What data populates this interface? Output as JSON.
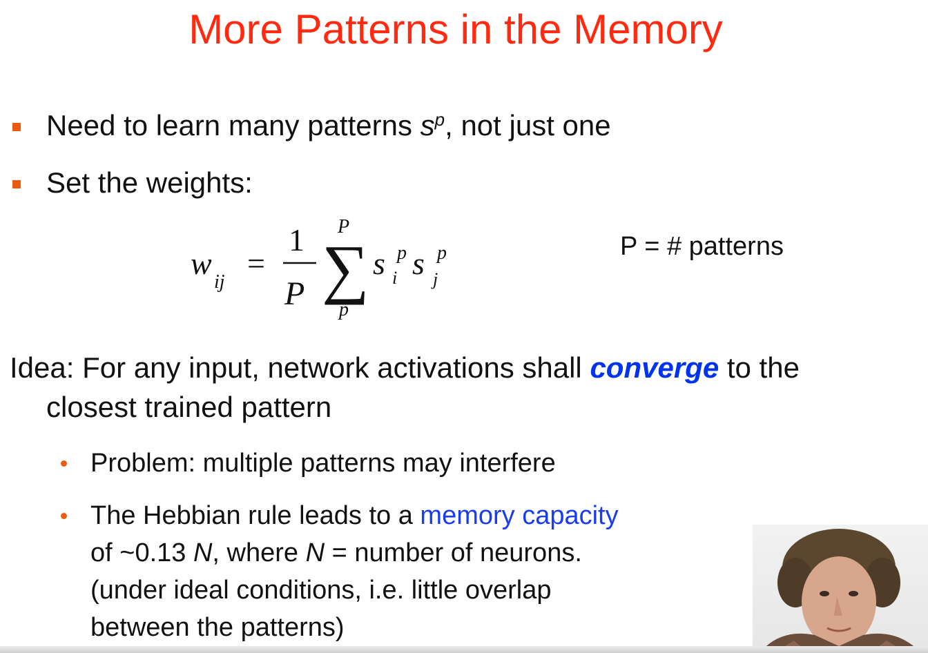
{
  "slide": {
    "title": "More Patterns in the Memory",
    "bullets": [
      {
        "text_before": "Need to learn many patterns ",
        "symbol": "s",
        "superscript": "p",
        "text_after": ", not just one"
      },
      {
        "text": "Set the weights:"
      }
    ],
    "formula": {
      "lhs_var": "w",
      "lhs_sub": "ij",
      "equals": "=",
      "numerator": "1",
      "denominator": "P",
      "sum_sign": "∑",
      "sum_upper": "P",
      "sum_lower": "p",
      "term_var": "s",
      "term_sup": "p",
      "term_sub_i": "i",
      "term_sub_j": "j"
    },
    "formula_legend": "P = # patterns",
    "idea": {
      "before": "Idea: For any input, network activations shall ",
      "emph": "converge",
      "after": " to the",
      "line2": "closest trained pattern"
    },
    "sub_bullets": [
      {
        "text": "Problem: multiple patterns may interfere"
      },
      {
        "p1_before": "The Hebbian rule leads to a ",
        "p1_link": "memory capacity",
        "p2_a": "of ~0.13 ",
        "p2_N1": "N",
        "p2_b": ", where ",
        "p2_N2": "N",
        "p2_c": " = number of neurons.",
        "p3": "(under ideal conditions, i.e. little overlap",
        "p4": "between the patterns)"
      }
    ]
  },
  "colors": {
    "title": "#ff2a10",
    "bullet": "#ea5a0f",
    "emphasis": "#0033ee",
    "link": "#1a3cf0"
  },
  "webcam": {
    "icon": "presenter-video-icon"
  }
}
